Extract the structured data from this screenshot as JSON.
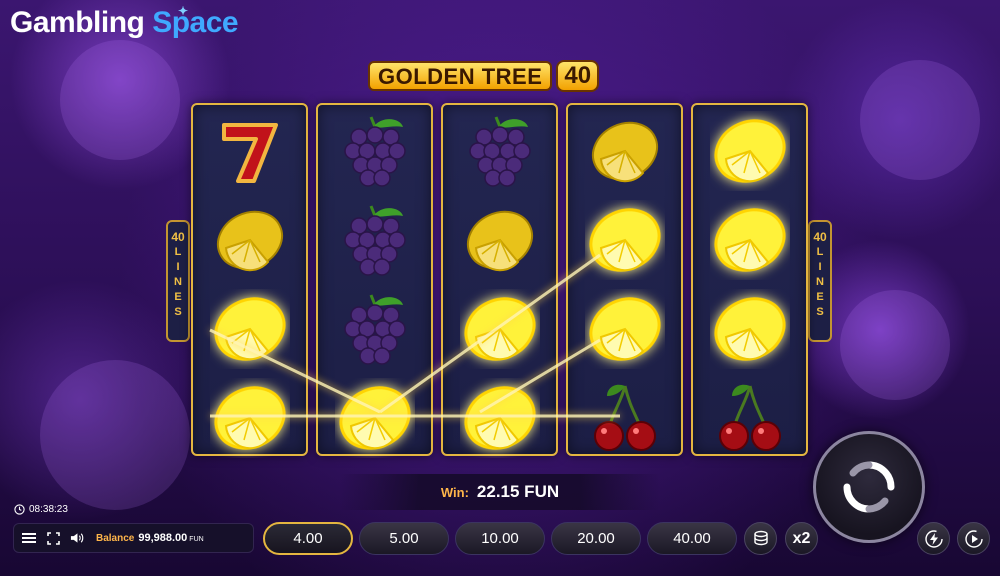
{
  "brand": {
    "word1": "Gambling",
    "word2": "Space"
  },
  "game": {
    "title": "GOLDEN TREE",
    "number": "40"
  },
  "lines_label": {
    "count": "40",
    "word": [
      "L",
      "I",
      "N",
      "E",
      "S"
    ]
  },
  "reels": [
    [
      "seven",
      "lemon",
      "lemon-glow",
      "lemon-glow"
    ],
    [
      "grapes",
      "grapes",
      "grapes",
      "lemon-glow"
    ],
    [
      "grapes",
      "lemon",
      "lemon-glow",
      "lemon-glow"
    ],
    [
      "lemon",
      "lemon-glow",
      "lemon-glow",
      "cherries"
    ],
    [
      "lemon-glow",
      "lemon-glow",
      "lemon-glow",
      "cherries"
    ]
  ],
  "win": {
    "label": "Win:",
    "amount": "22.15 FUN"
  },
  "clock": {
    "time": "08:38:23"
  },
  "balance": {
    "label": "Balance",
    "value": "99,988.00",
    "currency": "FUN"
  },
  "bets": {
    "options": [
      "4.00",
      "5.00",
      "10.00",
      "20.00",
      "40.00"
    ],
    "selected_index": 0
  },
  "multiplier_label": "x2",
  "icons": {
    "menu": "menu-icon",
    "fullscreen": "fullscreen-icon",
    "sound": "speaker-icon",
    "coins": "coin-stack-icon",
    "turbo": "lightning-icon",
    "autoplay": "play-icon",
    "spin": "spin-arrows-icon",
    "clock": "clock-icon"
  },
  "colors": {
    "accent_gold": "#e4b640",
    "win_label": "#ffb64a",
    "brand_blue": "#3fa9ff",
    "reel_bg": "#232651"
  }
}
